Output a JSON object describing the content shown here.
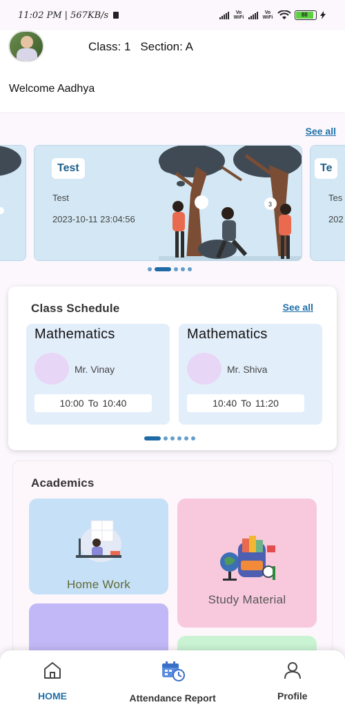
{
  "status_bar": {
    "time": "11:02 PM",
    "speed": "567KB/s",
    "vowifi_1": "Vo WiFi",
    "vowifi_2": "Vo WiFi",
    "battery": "88"
  },
  "header": {
    "class_label": "Class: 1",
    "section_label": "Section: A",
    "welcome": "Welcome Aadhya"
  },
  "banners": {
    "see_all": "See all",
    "left": {
      "title": "",
      "sub": "",
      "date": ""
    },
    "main": {
      "title": "Test",
      "sub": "Test",
      "date": "2023-10-11 23:04:56"
    },
    "right": {
      "title": "Te",
      "sub": "Tes",
      "date": "202"
    },
    "active_index": 1,
    "count": 5
  },
  "schedule": {
    "title": "Class Schedule",
    "see_all": "See all",
    "items": [
      {
        "subject": "Mathematics",
        "teacher": "Mr. Vinay",
        "start": "10:00",
        "to": "To",
        "end": "10:40"
      },
      {
        "subject": "Mathematics",
        "teacher": "Mr. Shiva",
        "start": "10:40",
        "to": "To",
        "end": "11:20"
      }
    ],
    "active_index": 0,
    "count": 6
  },
  "academics": {
    "title": "Academics",
    "tiles": [
      {
        "label": "Home Work",
        "color": "#c6e0f7"
      },
      {
        "label": "Study Material",
        "color": "#f8c9dd"
      },
      {
        "label": "",
        "color": "#c2b8f7"
      },
      {
        "label": "",
        "color": "#c9f3d3"
      }
    ]
  },
  "bottom_nav": {
    "items": [
      {
        "label": "HOME",
        "icon": "home-icon",
        "active": true
      },
      {
        "label": "Attendance Report",
        "icon": "calendar-clock-icon",
        "active": false
      },
      {
        "label": "Profile",
        "icon": "user-icon",
        "active": false
      }
    ],
    "active_color": "#1e6fa8"
  }
}
